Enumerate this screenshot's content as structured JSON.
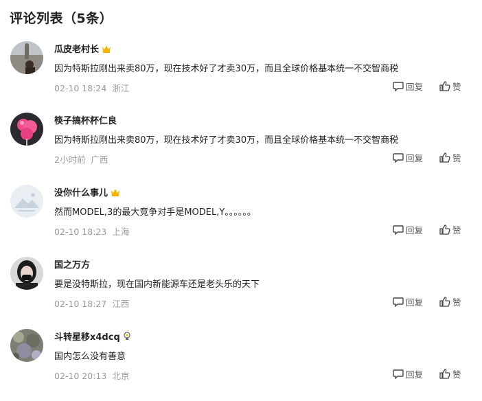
{
  "header": {
    "title": "评论列表（5条）"
  },
  "actions": {
    "reply_label": "回复",
    "like_label": "赞"
  },
  "comments": [
    {
      "author": "瓜皮老村长",
      "badge": "crown-icon",
      "text": "因为特斯拉刚出来卖80万，现在技术好了才卖30万，而且全球价格基本统一不交智商税",
      "time": "02-10 18:24",
      "location": "浙江"
    },
    {
      "author": "筷子搞杯杯仁良",
      "badge": "",
      "text": "因为特斯拉刚出来卖80万，现在技术好了才卖30万，而且全球价格基本统一不交智商税",
      "time": "2小时前",
      "location": "广西"
    },
    {
      "author": "没你什么事儿",
      "badge": "crown-icon",
      "text": "然而MODEL,3的最大竞争对手是MODEL,Y。。。。。。",
      "time": "02-10 18:23",
      "location": "上海"
    },
    {
      "author": "国之万方",
      "badge": "",
      "text": "要是没特斯拉，现在国内新能源车还是老头乐的天下",
      "time": "02-10 18:27",
      "location": "江西"
    },
    {
      "author": "斗转星移x4dcq",
      "badge": "bulb-badge-icon",
      "text": "国内怎么没有善意",
      "time": "02-10 20:13",
      "location": "北京"
    }
  ]
}
